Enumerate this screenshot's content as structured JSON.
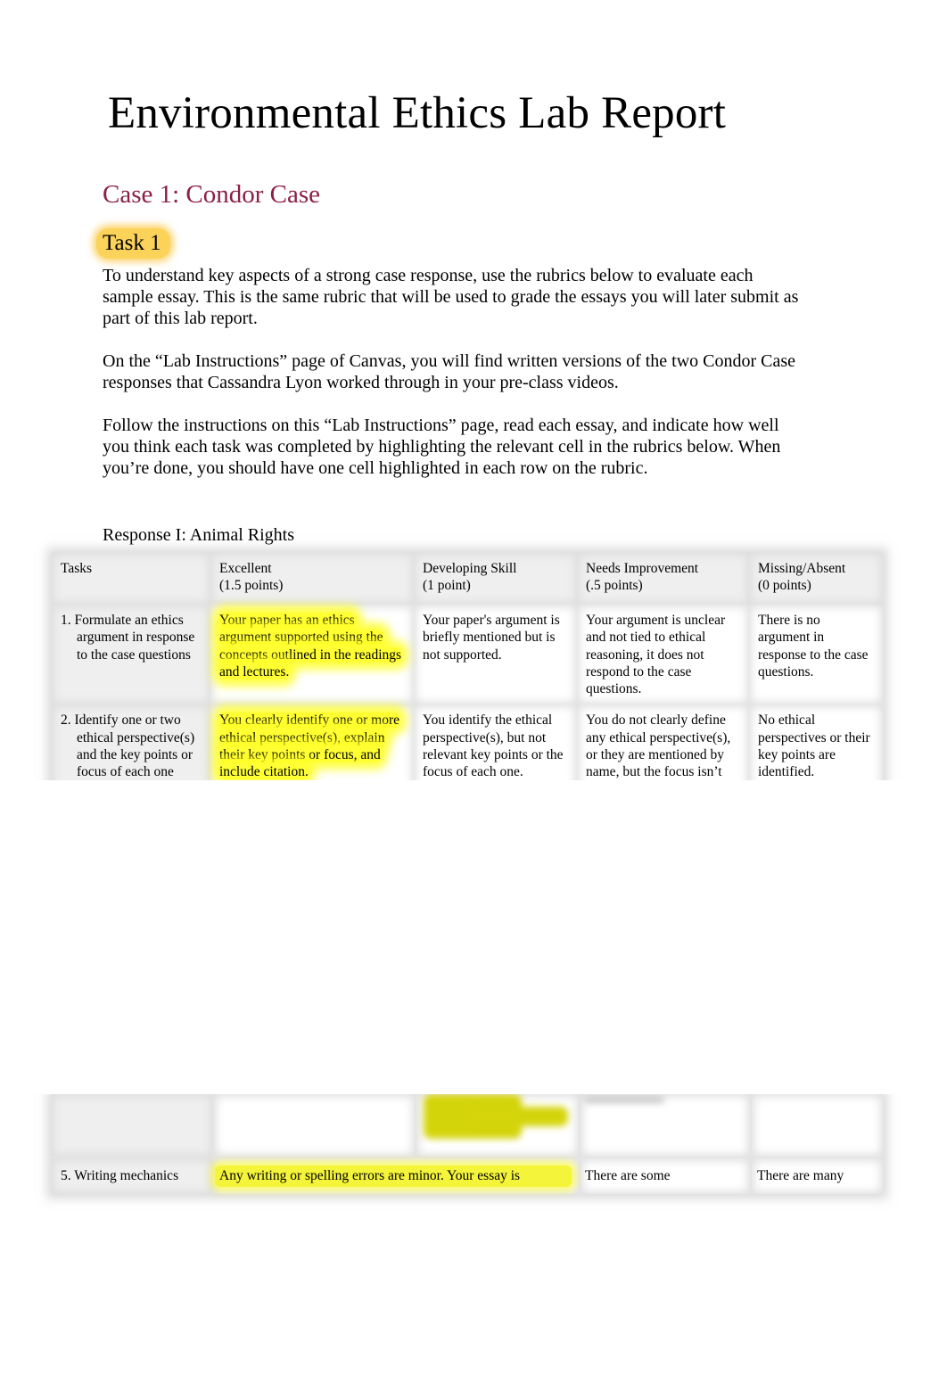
{
  "document": {
    "title": "Environmental Ethics Lab Report",
    "case_heading": "Case 1: Condor Case",
    "task_heading": "Task 1",
    "colors": {
      "case_heading": "#8b1f45",
      "task_highlight": "#fbd35a",
      "cell_highlight": "#ffff33"
    },
    "intro_paragraphs": [
      "To understand key aspects of a strong case response, use the rubrics below to evaluate each sample essay. This is the same rubric that will be used to grade the essays you will later submit as part of this lab report.",
      "On the “Lab Instructions” page of Canvas, you will find written versions of the two Condor Case responses that Cassandra Lyon worked through in your pre-class videos.",
      "Follow the instructions on this “Lab Instructions” page, read each essay, and indicate how well you think each task was completed by highlighting the relevant cell in the rubrics below. When you’re done, you should have one cell highlighted in each row on the rubric."
    ],
    "response_label": "Response I: Animal Rights"
  },
  "rubric": {
    "headers": [
      {
        "label": "Tasks",
        "points": ""
      },
      {
        "label": "Excellent",
        "points": "(1.5 points)"
      },
      {
        "label": "Developing Skill",
        "points": "(1 point)"
      },
      {
        "label": "Needs Improvement",
        "points": "(.5 points)"
      },
      {
        "label": "Missing/Absent",
        "points": "(0 points)"
      }
    ],
    "rows": [
      {
        "task": "1. Formulate an ethics argument in response to the case questions",
        "excellent": "Your paper has an ethics argument supported using the concepts outlined in the readings and lectures.",
        "developing": "Your paper's argument is briefly mentioned but is not supported.",
        "needs_improvement": "Your argument is unclear and not tied to ethical reasoning, it does not respond to the case questions.",
        "missing": "There is no argument in response to the case questions.",
        "highlighted": "excellent"
      },
      {
        "task": "2. Identify one or two ethical perspective(s) and the key points or focus of each one",
        "excellent": "You clearly identify one or more ethical perspective(s), explain their key points or focus, and include citation.",
        "developing": "You identify the ethical perspective(s), but not relevant key points or the focus of each one. Citation may be",
        "needs_improvement": "You do not clearly define any ethical perspective(s), or they are mentioned by name, but the focus isn’t",
        "missing": "No ethical perspectives or their key points are identified.",
        "highlighted": "excellent"
      },
      {
        "task": "5. Writing mechanics",
        "excellent": "Any writing or spelling errors are minor. Your essay is",
        "developing": "",
        "needs_improvement": "There are some",
        "missing": "There are many",
        "highlighted": "excellent"
      }
    ]
  }
}
